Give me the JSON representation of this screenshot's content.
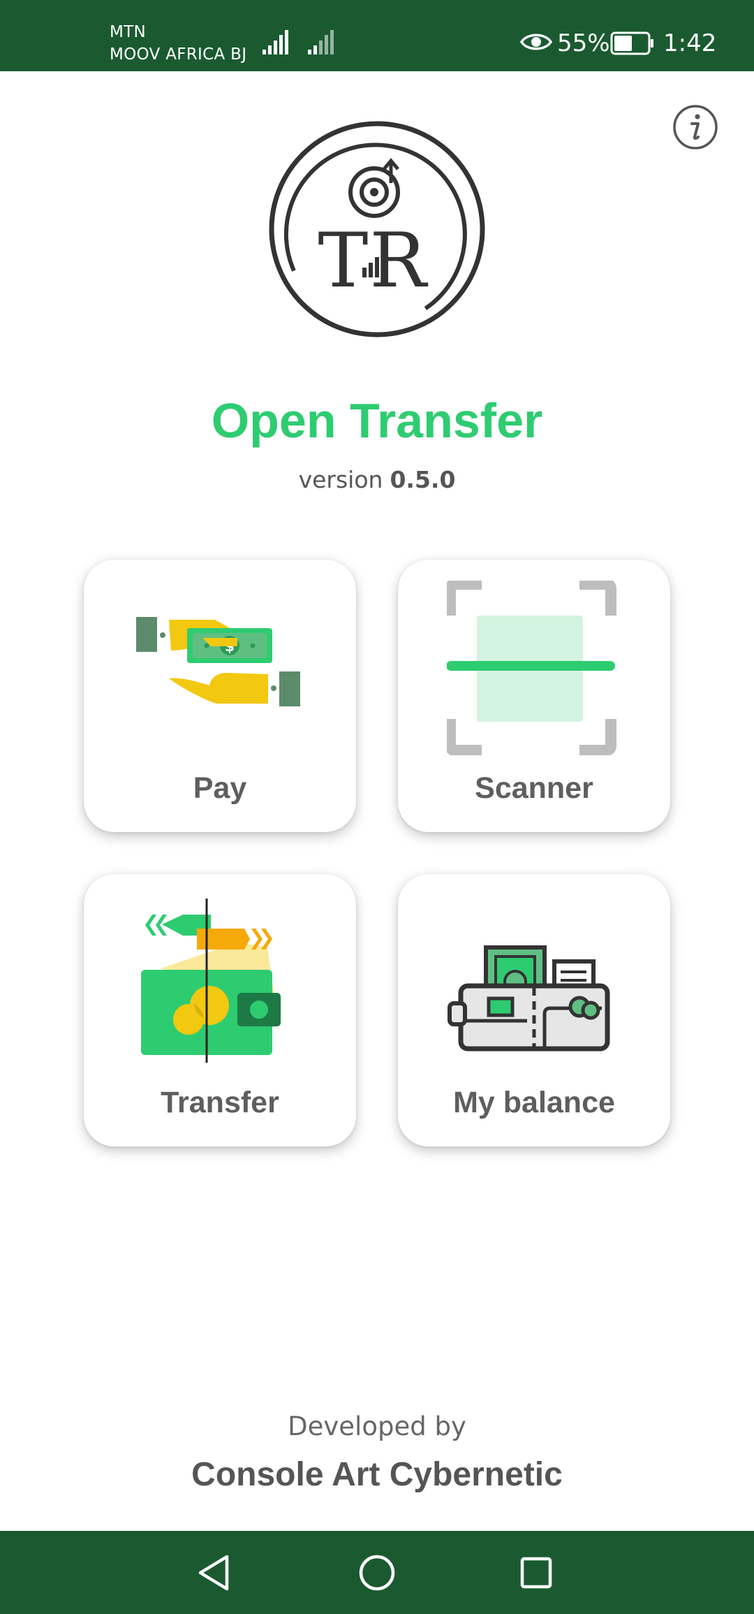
{
  "status_bar": {
    "carrier_1": "MTN",
    "carrier_2": "MOOV AFRICA BJ",
    "battery_percent": "55%",
    "battery_level": 0.55,
    "time": "1:42",
    "icons": [
      "signal-icon",
      "signal-icon",
      "eye-icon",
      "battery-icon"
    ]
  },
  "header": {
    "info_icon": "info-icon",
    "logo_text": "TR",
    "app_title": "Open Transfer",
    "version_label": "version",
    "version_number": "0.5.0"
  },
  "tiles": [
    {
      "label": "Pay",
      "icon": "pay-hands-money-icon"
    },
    {
      "label": "Scanner",
      "icon": "scanner-frame-icon"
    },
    {
      "label": "Transfer",
      "icon": "transfer-wallet-arrows-icon"
    },
    {
      "label": "My balance",
      "icon": "wallet-balance-icon"
    }
  ],
  "footer": {
    "developed_by": "Developed by",
    "developer": "Console Art Cybernetic"
  },
  "nav_bar": {
    "icons": [
      "back-triangle-icon",
      "home-circle-icon",
      "recents-square-icon"
    ]
  },
  "colors": {
    "system_bar": "#1b5a31",
    "accent_green": "#2ecc71",
    "dark_green": "#5c8c6b",
    "yellow": "#f2c811",
    "orange": "#f5a90b",
    "text_gray": "#5e5e5e",
    "logo_dark": "#333333"
  }
}
